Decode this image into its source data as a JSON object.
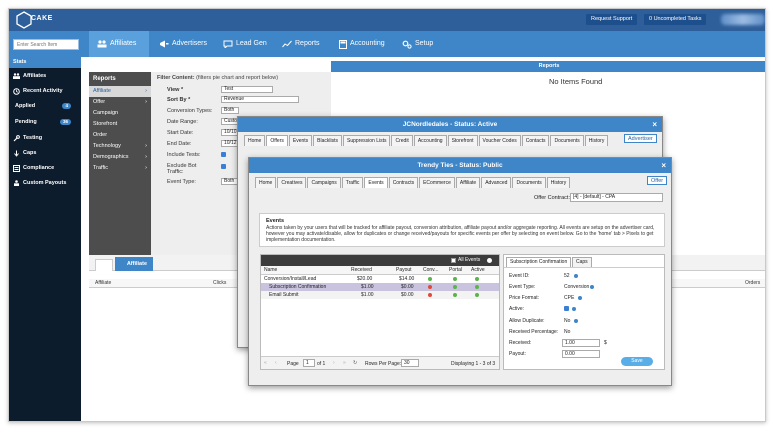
{
  "app": {
    "logo_text": "CAKE"
  },
  "topbar": {
    "support_label": "Request Support",
    "tasks_label": "0 Uncompleted Tasks"
  },
  "search": {
    "placeholder": "Enter Search Item"
  },
  "nav": [
    {
      "label": "Affiliates"
    },
    {
      "label": "Advertisers"
    },
    {
      "label": "Lead Gen"
    },
    {
      "label": "Reports"
    },
    {
      "label": "Accounting"
    },
    {
      "label": "Setup"
    }
  ],
  "sidebar": {
    "header": "Stats",
    "items": [
      {
        "label": "Affiliates"
      },
      {
        "label": "Recent Activity"
      },
      {
        "label": "Applied",
        "badge": "4"
      },
      {
        "label": "Pending",
        "badge": "36"
      },
      {
        "label": "Testing"
      },
      {
        "label": "Caps"
      },
      {
        "label": "Compliance"
      },
      {
        "label": "Custom Payouts"
      }
    ]
  },
  "reports": {
    "title": "Reports",
    "items": [
      "Affiliate",
      "Offer",
      "Campaign",
      "Storefront",
      "Order",
      "Technology",
      "Demographics",
      "Traffic"
    ]
  },
  "filter": {
    "title": "Filter Content:",
    "subtitle": "(filters pie chart and report below)",
    "view_label": "View *",
    "view_value": "Test",
    "sort_label": "Sort By *",
    "sort_value": "Revenue",
    "conv_label": "Conversion Types:",
    "conv_value": "Both",
    "date_range_label": "Date Range:",
    "date_range_value": "Custom",
    "start_label": "Start Date:",
    "start_value": "10/10",
    "end_label": "End Date:",
    "end_value": "10/12",
    "include_tests_label": "Include Tests:",
    "exclude_bot_label": "Exclude Bot Traffic:",
    "event_type_label": "Event Type:",
    "event_type_value": "Both"
  },
  "right": {
    "header": "Reports",
    "empty": "No Items Found"
  },
  "bottom": {
    "tab2": "Affiliate",
    "columns": [
      "Affiliate",
      "Clicks",
      "Orders"
    ]
  },
  "dialog1": {
    "title": "JCNordledales - Status: Active",
    "tabs": [
      "Home",
      "Offers",
      "Events",
      "Blacklists",
      "Suppression Lists",
      "Credit",
      "Accounting",
      "Storefront",
      "Voucher Codes",
      "Contacts",
      "Documents",
      "History"
    ],
    "active_tab": "Offers",
    "button": "Advertiser"
  },
  "dialog2": {
    "title": "Trendy Ties - Status: Public",
    "tabs": [
      "Home",
      "Creatives",
      "Campaigns",
      "Traffic",
      "Events",
      "Contracts",
      "ECommerce",
      "Affiliate",
      "Advanced",
      "Documents",
      "History"
    ],
    "active_tab": "Events",
    "button": "Offer",
    "offer_contract_label": "Offer Contract:",
    "offer_contract_value": "[4] - [default] - CPA",
    "events_title": "Events",
    "events_desc": "Actions taken by your users that will be tracked for affiliate payout, conversion attribution, affiliate payout and/or aggregate reporting. All events are setup on the advertiser card, however you may activate/disable, allow for duplicates or change received/payouts for specific events per offer by selecting on event below. Go to the 'home' tab > Pixels to get implementation documentation.",
    "all_events_label": "All Events",
    "table": {
      "columns": [
        "Name",
        "Received",
        "Payout",
        "Conv...",
        "Portal",
        "Active"
      ],
      "rows": [
        {
          "name": "Conversion/Install/Lead",
          "received": "$20.00",
          "payout": "$14.00"
        },
        {
          "name": "Subscription Confirmation",
          "received": "$1.00",
          "payout": "$0.00"
        },
        {
          "name": "Email Submit",
          "received": "$1.00",
          "payout": "$0.00"
        }
      ],
      "page_label": "Page",
      "page_value": "1",
      "of_label": "of 1",
      "rows_per_page_label": "Rows Per Page:",
      "rows_per_page_value": "30",
      "displaying": "Displaying 1 - 3 of 3"
    },
    "sub": {
      "tab1": "Subscription Confirmation",
      "tab2": "Caps",
      "fields": [
        {
          "label": "Event ID:",
          "value": "52"
        },
        {
          "label": "Event Type:",
          "value": "Conversion"
        },
        {
          "label": "Price Format:",
          "value": "CPE"
        },
        {
          "label": "Active:",
          "value": ""
        },
        {
          "label": "Allow Duplicate:",
          "value": "No"
        },
        {
          "label": "Received Percentage:",
          "value": "No"
        },
        {
          "label": "Received:",
          "value": "1.00"
        },
        {
          "label": "Payout:",
          "value": "0.00"
        }
      ],
      "currency": "$",
      "save_label": "Save"
    }
  },
  "colors": {
    "brand": "#2f5f9a",
    "accent": "#3e86c8",
    "sidebar": "#0d1c2c"
  }
}
